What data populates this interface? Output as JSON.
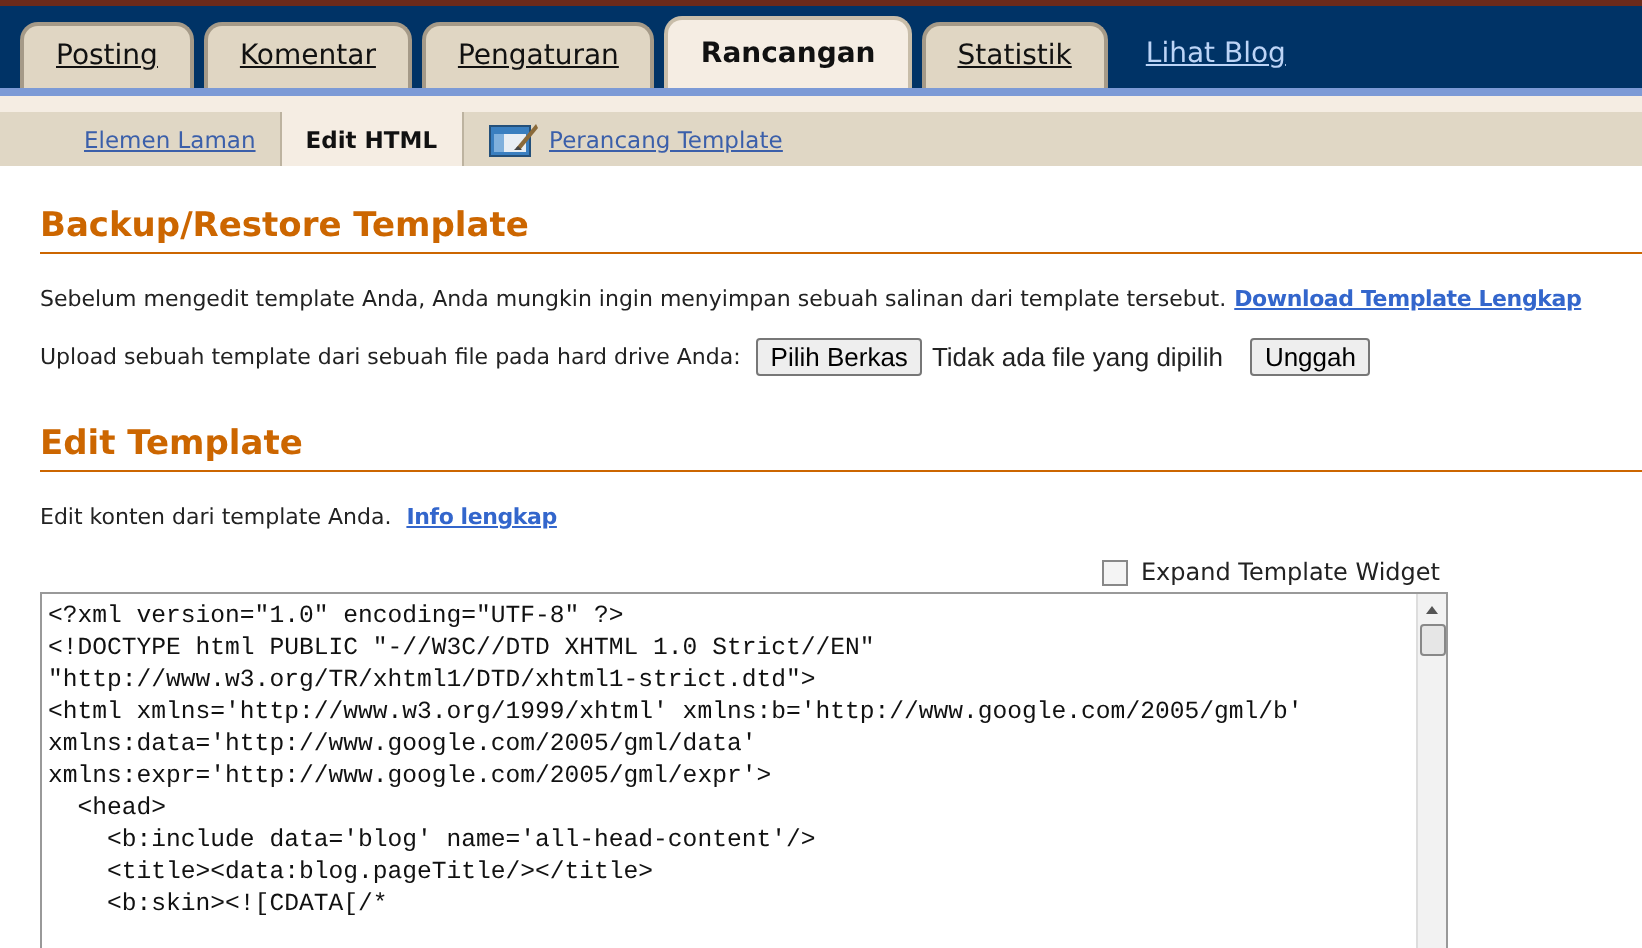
{
  "tabs": [
    {
      "label": "Posting",
      "selected": false
    },
    {
      "label": "Komentar",
      "selected": false
    },
    {
      "label": "Pengaturan",
      "selected": false
    },
    {
      "label": "Rancangan",
      "selected": true
    },
    {
      "label": "Statistik",
      "selected": false
    }
  ],
  "view_blog_link": "Lihat Blog",
  "subtabs": [
    {
      "label": "Elemen Laman",
      "selected": false,
      "kind": "link"
    },
    {
      "label": "Edit HTML",
      "selected": true,
      "kind": "link"
    },
    {
      "label": "Perancang Template",
      "selected": false,
      "kind": "icon-link"
    }
  ],
  "backup": {
    "heading": "Backup/Restore Template",
    "intro": "Sebelum mengedit template Anda, Anda mungkin ingin menyimpan sebuah salinan dari template tersebut.",
    "download_link": "Download Template Lengkap",
    "upload_label": "Upload sebuah template dari sebuah file pada hard drive Anda:",
    "choose_button": "Pilih Berkas",
    "file_status": "Tidak ada file yang dipilih",
    "upload_button": "Unggah"
  },
  "edit": {
    "heading": "Edit Template",
    "intro": "Edit konten dari template Anda.",
    "info_link": "Info lengkap",
    "expand_checkbox": {
      "label": "Expand Template Widget",
      "checked": false
    },
    "code_lines": [
      "<?xml version=\"1.0\" encoding=\"UTF-8\" ?>",
      "<!DOCTYPE html PUBLIC \"-//W3C//DTD XHTML 1.0 Strict//EN\"",
      "\"http://www.w3.org/TR/xhtml1/DTD/xhtml1-strict.dtd\">",
      "<html xmlns='http://www.w3.org/1999/xhtml' xmlns:b='http://www.google.com/2005/gml/b'",
      "xmlns:data='http://www.google.com/2005/gml/data'",
      "xmlns:expr='http://www.google.com/2005/gml/expr'>",
      "  <head>",
      "    <b:include data='blog' name='all-head-content'/>",
      "    <title><data:blog.pageTitle/></title>",
      "    <b:skin><![CDATA[/*"
    ]
  }
}
